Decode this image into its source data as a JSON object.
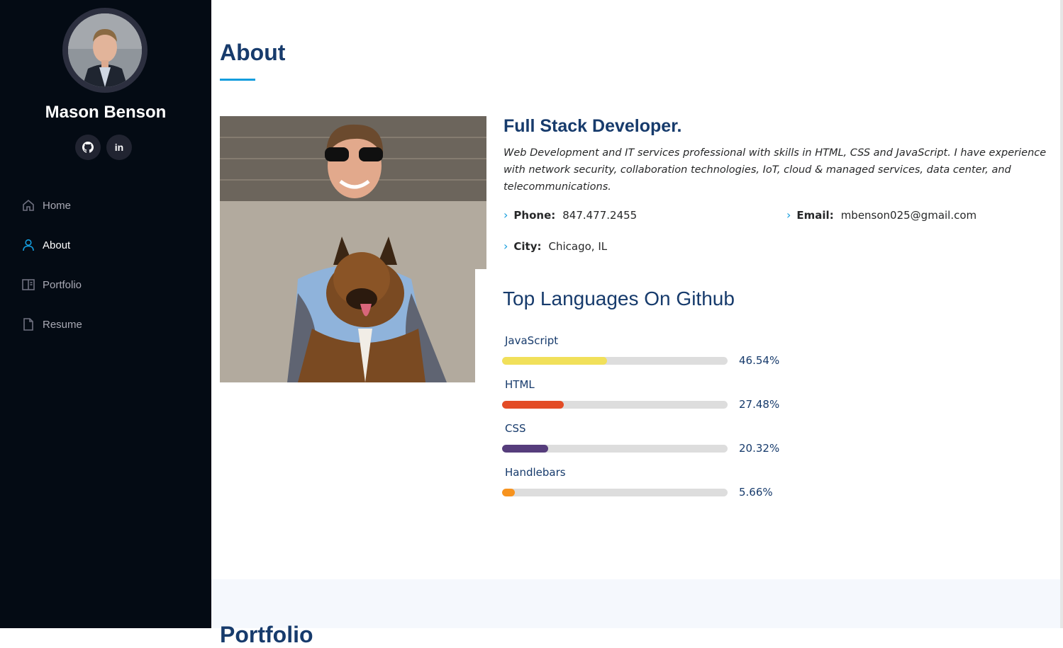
{
  "sidebar": {
    "name": "Mason Benson",
    "social": [
      "github-icon",
      "linkedin-icon"
    ],
    "linkedin_text": "in",
    "nav": [
      {
        "label": "Home",
        "icon": "home-icon",
        "active": false
      },
      {
        "label": "About",
        "icon": "user-icon",
        "active": true
      },
      {
        "label": "Portfolio",
        "icon": "portfolio-icon",
        "active": false
      },
      {
        "label": "Resume",
        "icon": "file-icon",
        "active": false
      }
    ]
  },
  "about": {
    "title": "About",
    "role": "Full Stack Developer.",
    "description": "Web Development and IT services professional with skills in HTML, CSS and JavaScript. I have experience with network security, collaboration technologies, IoT, cloud & managed services, data center, and telecommunications.",
    "phone_label": "Phone:",
    "phone": "847.477.2455",
    "email_label": "Email:",
    "email": "mbenson025@gmail.com",
    "city_label": "City:",
    "city": "Chicago, IL"
  },
  "languages": {
    "title": "Top Languages On Github",
    "items": [
      {
        "name": "JavaScript",
        "percent": 46.54,
        "percent_label": "46.54%",
        "color": "#f1e05a"
      },
      {
        "name": "HTML",
        "percent": 27.48,
        "percent_label": "27.48%",
        "color": "#e34c26"
      },
      {
        "name": "CSS",
        "percent": 20.32,
        "percent_label": "20.32%",
        "color": "#563d7c"
      },
      {
        "name": "Handlebars",
        "percent": 5.66,
        "percent_label": "5.66%",
        "color": "#f7931e"
      }
    ]
  },
  "next_section": {
    "title": "Portfolio"
  },
  "colors": {
    "accent": "#149ddd",
    "heading": "#173b6c",
    "sidebar_bg": "#040b14"
  }
}
